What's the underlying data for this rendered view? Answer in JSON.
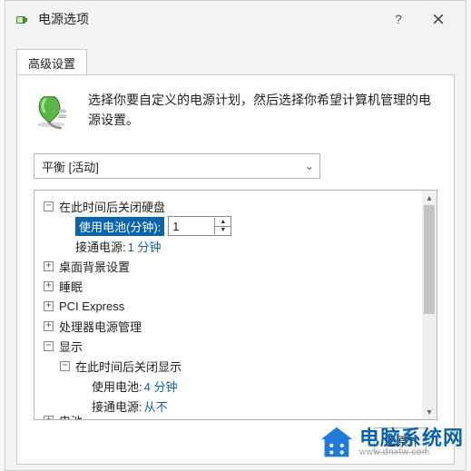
{
  "title": "电源选项",
  "tab": "高级设置",
  "description": "选择你要自定义的电源计划，然后选择你希望计算机管理的电源设置。",
  "plan": "平衡 [活动]",
  "tree": {
    "hdd": {
      "label": "在此时间后关闭硬盘",
      "battery_label": "使用电池(分钟):",
      "battery_value": "1",
      "ac_label": "接通电源:",
      "ac_value": "1 分钟"
    },
    "desktop_bg": "桌面背景设置",
    "sleep": "睡眠",
    "pci": "PCI Express",
    "cpu": "处理器电源管理",
    "display": {
      "label": "显示",
      "close": {
        "label": "在此时间后关闭显示",
        "battery_label": "使用电池:",
        "battery_value": "4 分钟",
        "ac_label": "接通电源:",
        "ac_value": "从不"
      }
    },
    "battery_group": "电池"
  },
  "restore_btn": "还原计划默认值(R)",
  "watermark": {
    "cn": "电脑系统网",
    "en": "www.dnxtw.com"
  }
}
